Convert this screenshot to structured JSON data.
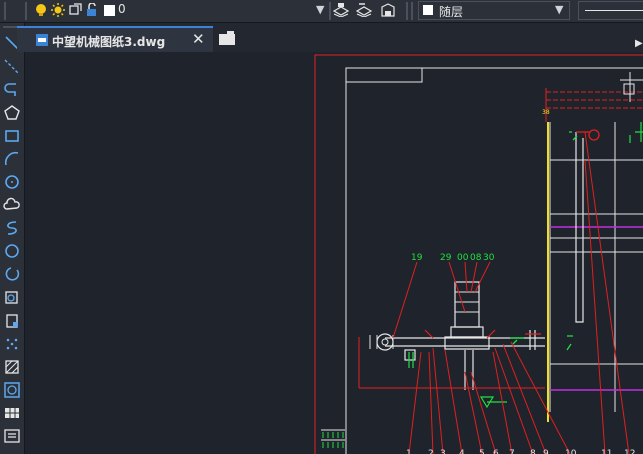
{
  "toolbar": {
    "layer_value": "0",
    "property_value": "随层",
    "icons": [
      "lightbulb-icon",
      "sun-icon",
      "layer-freeze-icon",
      "lock-icon",
      "color-square-icon",
      "layer-state-icon",
      "layer-match-icon",
      "layer-previous-icon"
    ]
  },
  "tab": {
    "title": "中望机械图纸3.dwg",
    "close": "✕",
    "menu": "▼"
  },
  "left_tools": [
    "line-icon",
    "construction-line-icon",
    "polyline-icon",
    "polygon-icon",
    "rectangle-icon",
    "arc-icon",
    "circle-icon",
    "revision-cloud-icon",
    "spline-icon",
    "ellipse-icon",
    "ellipse-arc-icon",
    "insert-block-icon",
    "make-block-icon",
    "point-icon",
    "hatch-icon",
    "region-icon",
    "table-icon",
    "multiline-text-icon"
  ],
  "drawing": {
    "labels_top": [
      "19",
      "29",
      "00",
      "08",
      "30"
    ],
    "labels_bottom": [
      "1",
      "2",
      "3",
      "4",
      "5",
      "6",
      "7",
      "8",
      "9",
      "10",
      "11",
      "12"
    ],
    "small_label": "38"
  }
}
